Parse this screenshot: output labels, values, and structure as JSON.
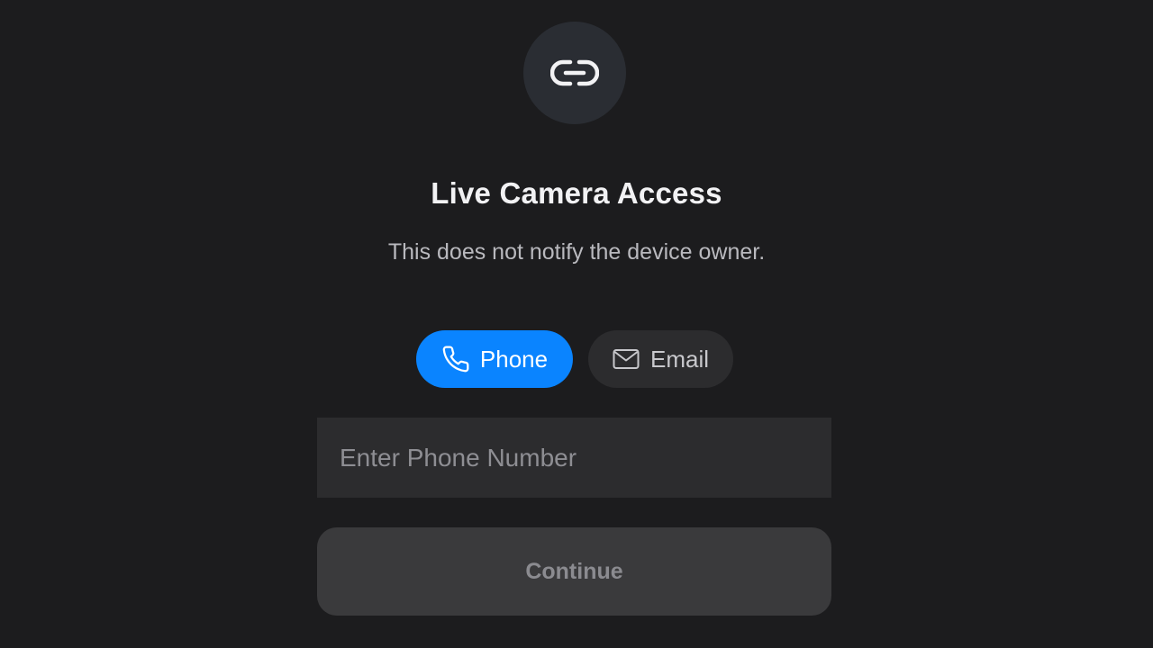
{
  "header": {
    "icon": "link-icon",
    "title": "Live Camera Access",
    "subtitle": "This does not notify the device owner."
  },
  "tabs": [
    {
      "label": "Phone",
      "icon": "phone-icon",
      "active": true
    },
    {
      "label": "Email",
      "icon": "mail-icon",
      "active": false
    }
  ],
  "form": {
    "phone_placeholder": "Enter Phone Number",
    "phone_value": "",
    "continue_label": "Continue",
    "continue_enabled": false
  },
  "colors": {
    "background": "#1c1c1e",
    "accent": "#0a84ff",
    "surface": "#2c2c2e",
    "button_disabled": "#3a3a3c"
  }
}
